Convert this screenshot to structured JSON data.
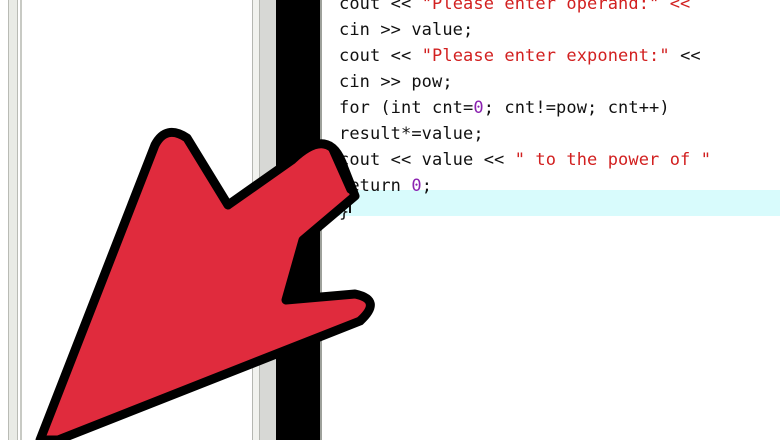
{
  "editor": {
    "lines": [
      {
        "parts": [
          {
            "t": "cout << ",
            "c": "kw"
          },
          {
            "t": "\"Please enter operand:\" << ",
            "c": "str"
          }
        ]
      },
      {
        "parts": [
          {
            "t": "cin >> value;",
            "c": "kw"
          }
        ]
      },
      {
        "parts": [
          {
            "t": "cout << ",
            "c": "kw"
          },
          {
            "t": "\"Please enter exponent:\"",
            "c": "str"
          },
          {
            "t": " <<",
            "c": "kw"
          }
        ]
      },
      {
        "parts": [
          {
            "t": "cin >> pow;",
            "c": "kw"
          }
        ]
      },
      {
        "parts": [
          {
            "t": "for (int cnt=",
            "c": "kw"
          },
          {
            "t": "0",
            "c": "num"
          },
          {
            "t": "; cnt!=pow; cnt++)",
            "c": "kw"
          }
        ]
      },
      {
        "parts": [
          {
            "t": "result*=value;",
            "c": "kw"
          }
        ]
      },
      {
        "parts": [
          {
            "t": "cout << value << ",
            "c": "kw"
          },
          {
            "t": "\" to the power of \"",
            "c": "str"
          }
        ]
      },
      {
        "parts": [
          {
            "t": "return ",
            "c": "kw"
          },
          {
            "t": "0",
            "c": "num"
          },
          {
            "t": ";",
            "c": "kw"
          }
        ]
      },
      {
        "parts": [
          {
            "t": "}",
            "c": "kw"
          }
        ]
      }
    ]
  },
  "overlay": {
    "arrow_icon": "arrow-pointer-icon",
    "arrow_color": "#e02b3d"
  },
  "colors": {
    "string": "#d22020",
    "number": "#8b22b0",
    "current_line": "#d8fbfc"
  }
}
